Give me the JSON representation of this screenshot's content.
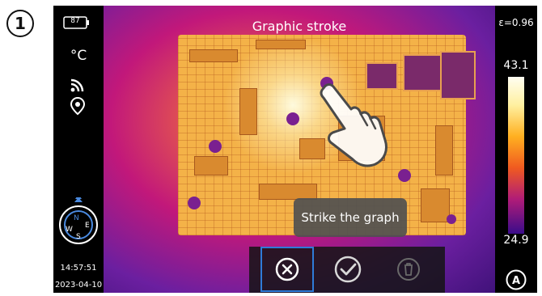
{
  "step": {
    "number": "1"
  },
  "status": {
    "battery_level": "87"
  },
  "left_panel": {
    "unit": "°C",
    "time": "14:57:51",
    "date": "2023-04-10"
  },
  "compass": {
    "n": "N",
    "e": "E",
    "s": "S",
    "w": "W"
  },
  "header": {
    "title": "Graphic stroke"
  },
  "toast": {
    "message": "Strike the graph"
  },
  "right_panel": {
    "emissivity": "ε=0.96",
    "temp_max": "43.1",
    "temp_min": "24.9",
    "auto_label": "A"
  },
  "actions": [
    {
      "name": "cancel",
      "icon": "close-circle-icon",
      "selected": true
    },
    {
      "name": "confirm",
      "icon": "check-circle-icon",
      "selected": false
    },
    {
      "name": "delete",
      "icon": "trash-icon",
      "selected": false,
      "disabled": true
    }
  ],
  "colors": {
    "selection": "#2f7bd8",
    "scale_top": "#fffef2",
    "scale_bottom": "#3a0c8a"
  }
}
